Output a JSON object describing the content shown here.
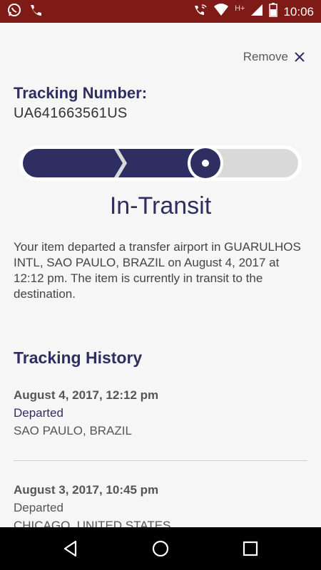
{
  "status_bar": {
    "time": "10:06",
    "network": "H+",
    "icons": [
      "whatsapp-icon",
      "phone-icon",
      "wifi-call-icon",
      "wifi-icon",
      "signal-icon",
      "battery-icon"
    ]
  },
  "header": {
    "remove_label": "Remove"
  },
  "tracking": {
    "label": "Tracking Number:",
    "number": "UA641663561US"
  },
  "progress": {
    "completed_steps": 2,
    "current_step": 3,
    "total_steps": 4,
    "color_done": "#2f2e62",
    "color_pending": "#d9d9d9"
  },
  "status": {
    "title": "In-Transit",
    "description": "Your item departed a transfer airport in GUARULHOS INTL, SAO PAULO, BRAZIL on August 4, 2017 at 12:12 pm. The item is currently in transit to the destination."
  },
  "history": {
    "title": "Tracking History",
    "entries": [
      {
        "date": "August 4, 2017, 12:12 pm",
        "event": "Departed",
        "location": "SAO PAULO, BRAZIL"
      },
      {
        "date": "August 3, 2017, 10:45 pm",
        "event": "Departed",
        "location": "CHICAGO, UNITED STATES"
      }
    ]
  },
  "colors": {
    "status_bar": "#7e1b17",
    "accent": "#2f2e62",
    "background": "#f6f6f6"
  }
}
